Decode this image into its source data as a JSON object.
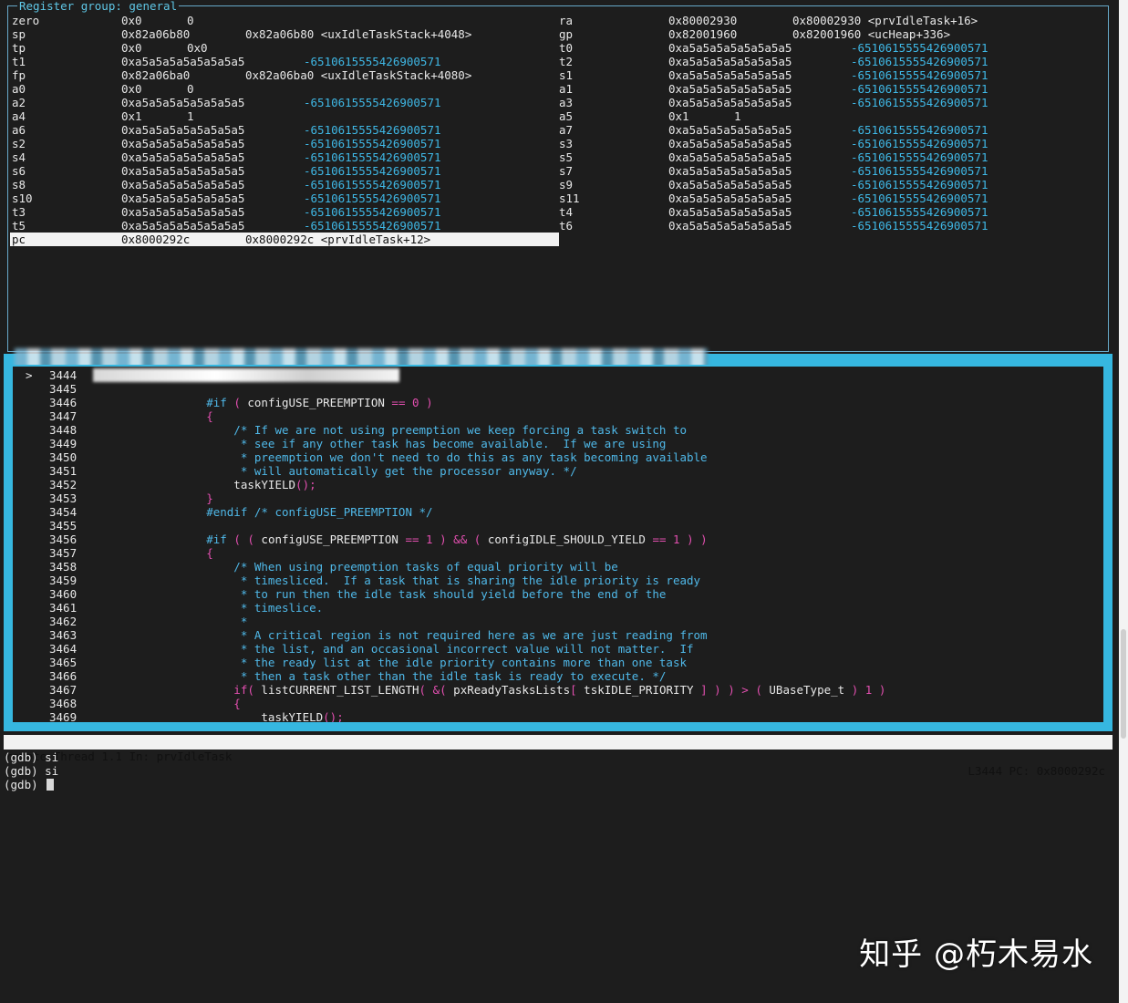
{
  "register_pane": {
    "title": "Register group: general",
    "left": [
      {
        "name": "zero",
        "hex": "0x0",
        "val": "0",
        "kind": "plain"
      },
      {
        "name": "sp",
        "hex": "0x82a06b80",
        "val": "0x82a06b80 <uxIdleTaskStack+4048>",
        "kind": "sym"
      },
      {
        "name": "tp",
        "hex": "0x0",
        "val": "0x0",
        "kind": "plain"
      },
      {
        "name": "t1",
        "hex": "0xa5a5a5a5a5a5a5a5",
        "val": "-6510615555426900571",
        "kind": "dec"
      },
      {
        "name": "fp",
        "hex": "0x82a06ba0",
        "val": "0x82a06ba0 <uxIdleTaskStack+4080>",
        "kind": "sym"
      },
      {
        "name": "a0",
        "hex": "0x0",
        "val": "0",
        "kind": "plain"
      },
      {
        "name": "a2",
        "hex": "0xa5a5a5a5a5a5a5a5",
        "val": "-6510615555426900571",
        "kind": "dec"
      },
      {
        "name": "a4",
        "hex": "0x1",
        "val": "1",
        "kind": "plain"
      },
      {
        "name": "a6",
        "hex": "0xa5a5a5a5a5a5a5a5",
        "val": "-6510615555426900571",
        "kind": "dec"
      },
      {
        "name": "s2",
        "hex": "0xa5a5a5a5a5a5a5a5",
        "val": "-6510615555426900571",
        "kind": "dec"
      },
      {
        "name": "s4",
        "hex": "0xa5a5a5a5a5a5a5a5",
        "val": "-6510615555426900571",
        "kind": "dec"
      },
      {
        "name": "s6",
        "hex": "0xa5a5a5a5a5a5a5a5",
        "val": "-6510615555426900571",
        "kind": "dec"
      },
      {
        "name": "s8",
        "hex": "0xa5a5a5a5a5a5a5a5",
        "val": "-6510615555426900571",
        "kind": "dec"
      },
      {
        "name": "s10",
        "hex": "0xa5a5a5a5a5a5a5a5",
        "val": "-6510615555426900571",
        "kind": "dec"
      },
      {
        "name": "t3",
        "hex": "0xa5a5a5a5a5a5a5a5",
        "val": "-6510615555426900571",
        "kind": "dec"
      },
      {
        "name": "t5",
        "hex": "0xa5a5a5a5a5a5a5a5",
        "val": "-6510615555426900571",
        "kind": "dec"
      }
    ],
    "right": [
      {
        "name": "ra",
        "hex": "0x80002930",
        "val": "0x80002930 <prvIdleTask+16>",
        "kind": "sym"
      },
      {
        "name": "gp",
        "hex": "0x82001960",
        "val": "0x82001960 <ucHeap+336>",
        "kind": "sym"
      },
      {
        "name": "t0",
        "hex": "0xa5a5a5a5a5a5a5a5",
        "val": "-6510615555426900571",
        "kind": "dec"
      },
      {
        "name": "t2",
        "hex": "0xa5a5a5a5a5a5a5a5",
        "val": "-6510615555426900571",
        "kind": "dec"
      },
      {
        "name": "s1",
        "hex": "0xa5a5a5a5a5a5a5a5",
        "val": "-6510615555426900571",
        "kind": "dec"
      },
      {
        "name": "a1",
        "hex": "0xa5a5a5a5a5a5a5a5",
        "val": "-6510615555426900571",
        "kind": "dec"
      },
      {
        "name": "a3",
        "hex": "0xa5a5a5a5a5a5a5a5",
        "val": "-6510615555426900571",
        "kind": "dec"
      },
      {
        "name": "a5",
        "hex": "0x1",
        "val": "1",
        "kind": "plain"
      },
      {
        "name": "a7",
        "hex": "0xa5a5a5a5a5a5a5a5",
        "val": "-6510615555426900571",
        "kind": "dec"
      },
      {
        "name": "s3",
        "hex": "0xa5a5a5a5a5a5a5a5",
        "val": "-6510615555426900571",
        "kind": "dec"
      },
      {
        "name": "s5",
        "hex": "0xa5a5a5a5a5a5a5a5",
        "val": "-6510615555426900571",
        "kind": "dec"
      },
      {
        "name": "s7",
        "hex": "0xa5a5a5a5a5a5a5a5",
        "val": "-6510615555426900571",
        "kind": "dec"
      },
      {
        "name": "s9",
        "hex": "0xa5a5a5a5a5a5a5a5",
        "val": "-6510615555426900571",
        "kind": "dec"
      },
      {
        "name": "s11",
        "hex": "0xa5a5a5a5a5a5a5a5",
        "val": "-6510615555426900571",
        "kind": "dec"
      },
      {
        "name": "t4",
        "hex": "0xa5a5a5a5a5a5a5a5",
        "val": "-6510615555426900571",
        "kind": "dec"
      },
      {
        "name": "t6",
        "hex": "0xa5a5a5a5a5a5a5a5",
        "val": "-6510615555426900571",
        "kind": "dec"
      }
    ],
    "pc": {
      "name": "pc",
      "hex": "0x8000292c",
      "val": "0x8000292c <prvIdleTask+12>"
    }
  },
  "source_pane": {
    "current_marker": ">",
    "lines": [
      {
        "n": "3444",
        "tokens": []
      },
      {
        "n": "3445",
        "tokens": []
      },
      {
        "n": "3446",
        "tokens": [
          [
            "pre",
            "        #if "
          ],
          [
            "kw",
            "( "
          ],
          [
            "id",
            "configUSE_PREEMPTION "
          ],
          [
            "op",
            "== "
          ],
          [
            "num",
            "0 "
          ],
          [
            "kw",
            ")"
          ]
        ]
      },
      {
        "n": "3447",
        "tokens": [
          [
            "kw",
            "        {"
          ]
        ]
      },
      {
        "n": "3448",
        "tokens": [
          [
            "cm",
            "            /* If we are not using preemption we keep forcing a task switch to"
          ]
        ]
      },
      {
        "n": "3449",
        "tokens": [
          [
            "cm",
            "             * see if any other task has become available.  If we are using"
          ]
        ]
      },
      {
        "n": "3450",
        "tokens": [
          [
            "cm",
            "             * preemption we don't need to do this as any task becoming available"
          ]
        ]
      },
      {
        "n": "3451",
        "tokens": [
          [
            "cm",
            "             * will automatically get the processor anyway. */"
          ]
        ]
      },
      {
        "n": "3452",
        "tokens": [
          [
            "id",
            "            taskYIELD"
          ],
          [
            "kw",
            "();"
          ]
        ]
      },
      {
        "n": "3453",
        "tokens": [
          [
            "kw",
            "        }"
          ]
        ]
      },
      {
        "n": "3454",
        "tokens": [
          [
            "pre",
            "        #endif "
          ],
          [
            "cm",
            "/* configUSE_PREEMPTION */"
          ]
        ]
      },
      {
        "n": "3455",
        "tokens": []
      },
      {
        "n": "3456",
        "tokens": [
          [
            "pre",
            "        #if "
          ],
          [
            "kw",
            "( ( "
          ],
          [
            "id",
            "configUSE_PREEMPTION "
          ],
          [
            "op",
            "== "
          ],
          [
            "num",
            "1 "
          ],
          [
            "kw",
            ") "
          ],
          [
            "op",
            "&& "
          ],
          [
            "kw",
            "( "
          ],
          [
            "id",
            "configIDLE_SHOULD_YIELD "
          ],
          [
            "op",
            "== "
          ],
          [
            "num",
            "1 "
          ],
          [
            "kw",
            ") )"
          ]
        ]
      },
      {
        "n": "3457",
        "tokens": [
          [
            "kw",
            "        {"
          ]
        ]
      },
      {
        "n": "3458",
        "tokens": [
          [
            "cm",
            "            /* When using preemption tasks of equal priority will be"
          ]
        ]
      },
      {
        "n": "3459",
        "tokens": [
          [
            "cm",
            "             * timesliced.  If a task that is sharing the idle priority is ready"
          ]
        ]
      },
      {
        "n": "3460",
        "tokens": [
          [
            "cm",
            "             * to run then the idle task should yield before the end of the"
          ]
        ]
      },
      {
        "n": "3461",
        "tokens": [
          [
            "cm",
            "             * timeslice."
          ]
        ]
      },
      {
        "n": "3462",
        "tokens": [
          [
            "cm",
            "             *"
          ]
        ]
      },
      {
        "n": "3463",
        "tokens": [
          [
            "cm",
            "             * A critical region is not required here as we are just reading from"
          ]
        ]
      },
      {
        "n": "3464",
        "tokens": [
          [
            "cm",
            "             * the list, and an occasional incorrect value will not matter.  If"
          ]
        ]
      },
      {
        "n": "3465",
        "tokens": [
          [
            "cm",
            "             * the ready list at the idle priority contains more than one task"
          ]
        ]
      },
      {
        "n": "3466",
        "tokens": [
          [
            "cm",
            "             * then a task other than the idle task is ready to execute. */"
          ]
        ]
      },
      {
        "n": "3467",
        "tokens": [
          [
            "kw",
            "            if( "
          ],
          [
            "id",
            "listCURRENT_LIST_LENGTH"
          ],
          [
            "kw",
            "( "
          ],
          [
            "op",
            "&"
          ],
          [
            "kw",
            "( "
          ],
          [
            "id",
            "pxReadyTasksLists"
          ],
          [
            "kw",
            "[ "
          ],
          [
            "id",
            "tskIDLE_PRIORITY "
          ],
          [
            "kw",
            "] ) ) "
          ],
          [
            "op",
            "> "
          ],
          [
            "kw",
            "( "
          ],
          [
            "id",
            "UBaseType_t "
          ],
          [
            "kw",
            ") "
          ],
          [
            "num",
            "1 "
          ],
          [
            "kw",
            ")"
          ]
        ]
      },
      {
        "n": "3468",
        "tokens": [
          [
            "kw",
            "            {"
          ]
        ]
      },
      {
        "n": "3469",
        "tokens": [
          [
            "id",
            "                taskYIELD"
          ],
          [
            "kw",
            "();"
          ]
        ]
      }
    ]
  },
  "status_bar": {
    "left": "remote Thread 1.1 In: prvIdleTask",
    "right": "L3444 PC: 0x8000292c"
  },
  "command_pane": {
    "lines": [
      "(gdb) si",
      "(gdb) si",
      "(gdb) "
    ]
  },
  "watermark": "知乎 @朽木易水",
  "colors": {
    "background": "#1d1d1d",
    "accent_border": "#36b7e0",
    "comment": "#4fb8e8",
    "keyword": "#e34fb0",
    "decimal_value": "#3fb8e6"
  }
}
